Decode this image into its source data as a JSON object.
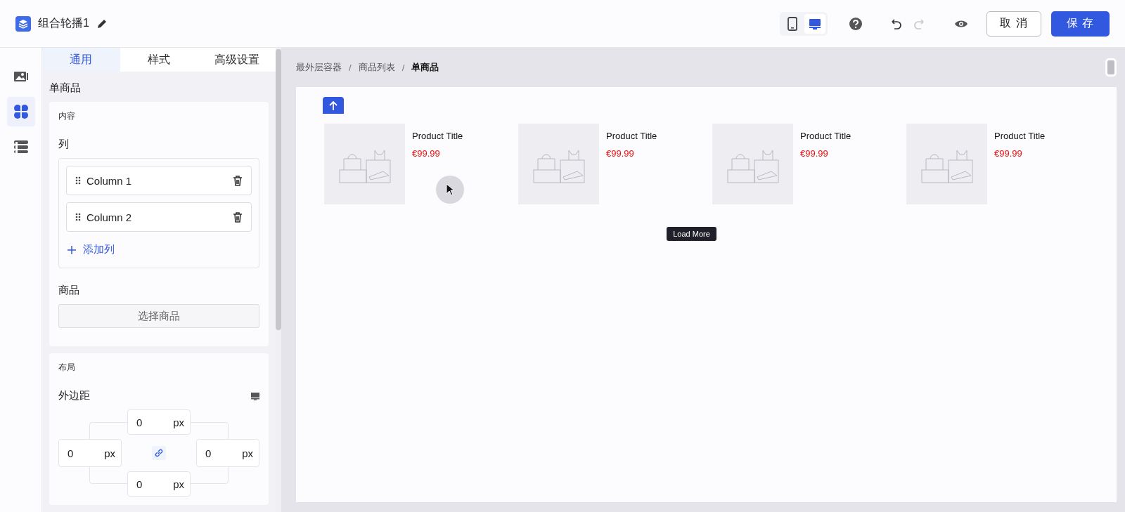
{
  "header": {
    "title": "组合轮播1",
    "devices": [
      {
        "kind": "mobile",
        "selected": false
      },
      {
        "kind": "desktop",
        "selected": true
      }
    ],
    "undo": {
      "disabled": false
    },
    "redo": {
      "disabled": true
    },
    "cancel": "取 消",
    "save": "保 存"
  },
  "rail": [
    {
      "kind": "images",
      "selected": false
    },
    {
      "kind": "components",
      "selected": true
    },
    {
      "kind": "layers",
      "selected": false
    }
  ],
  "tabs": [
    {
      "label": "通用",
      "selected": true
    },
    {
      "label": "样式",
      "selected": false
    },
    {
      "label": "高级设置",
      "selected": false
    }
  ],
  "section_title": "单商品",
  "content_card": {
    "title": "内容",
    "columns_label": "列",
    "columns": [
      "Column 1",
      "Column 2"
    ],
    "add_column": "添加列",
    "products_label": "商品",
    "choose_products": "选择商品"
  },
  "layout_card": {
    "title": "布局",
    "margin_label": "外边距",
    "margins": {
      "top": {
        "value": "0",
        "unit": "px"
      },
      "left": {
        "value": "0",
        "unit": "px"
      },
      "right": {
        "value": "0",
        "unit": "px"
      },
      "bottom": {
        "value": "0",
        "unit": "px"
      }
    }
  },
  "breadcrumb_separator": "/",
  "breadcrumb": [
    {
      "label": "最外层容器",
      "current": false
    },
    {
      "label": "商品列表",
      "current": false
    },
    {
      "label": "单商品",
      "current": true
    }
  ],
  "products": [
    {
      "title": "Product Title",
      "price": "€99.99",
      "selected": true
    },
    {
      "title": "Product Title",
      "price": "€99.99",
      "selected": false
    },
    {
      "title": "Product Title",
      "price": "€99.99",
      "selected": false
    },
    {
      "title": "Product Title",
      "price": "€99.99",
      "selected": false
    }
  ],
  "load_more": "Load More"
}
